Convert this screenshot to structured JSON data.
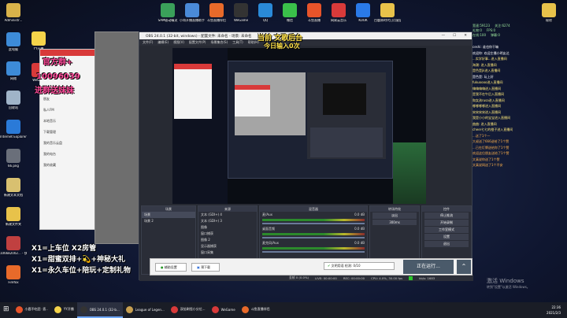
{
  "desktop_left": [
    {
      "label": "Administr...",
      "color": "#d8b24a"
    },
    {
      "label": "此电脑",
      "color": "#3d8bd8"
    },
    {
      "label": "网络",
      "color": "#3d8bd8"
    },
    {
      "label": "回收站",
      "color": "#a0b4c8"
    },
    {
      "label": "Internet Explorer",
      "color": "#2a7ad8"
    },
    {
      "label": "66.png",
      "color": "#6a6f7a"
    },
    {
      "label": "新建文本文档",
      "color": "#d8c070"
    },
    {
      "label": "新建文件夹",
      "color": "#e8c24a"
    },
    {
      "label": "106682002... - 快捷方式",
      "color": "#c04040"
    },
    {
      "label": "Firefox",
      "color": "#e86a2a"
    }
  ],
  "desktop_second_col": [
    {
      "label": "YY开播",
      "color": "#f5d44a"
    },
    {
      "label": "WeGa...",
      "color": "#d83a3a"
    }
  ],
  "desktop_top": [
    {
      "label": "SAM驱动精灵",
      "color": "#3aa05a"
    },
    {
      "label": "小哥开播直播助手",
      "color": "#4a8ad8"
    },
    {
      "label": "斗鱼直播伴侣",
      "color": "#e86a2a"
    },
    {
      "label": "WeGame",
      "color": "#333"
    },
    {
      "label": "QQ",
      "color": "#2a8ad8"
    },
    {
      "label": "微信",
      "color": "#3ac04a"
    },
    {
      "label": "斗鱼直播",
      "color": "#e8542a"
    },
    {
      "label": "网易云音乐",
      "color": "#d83a3a"
    },
    {
      "label": "KOOK",
      "color": "#2a7ae8"
    },
    {
      "label": "白鹿原时代日月星辰",
      "color": "#e8c24a"
    }
  ],
  "desktop_right_icon": {
    "label": "秘密",
    "color": "#e8c24a"
  },
  "obs": {
    "title": "OBS 24.0.1 (32-bit, windows) - 配置文件: 未命名 - 场景: 未命名",
    "menu": [
      "文件(F)",
      "编辑(E)",
      "视图(V)",
      "配置文件(P)",
      "场景集合(S)",
      "工具(T)",
      "帮助(H)"
    ],
    "scenes_header": "场景",
    "scenes": [
      "场景",
      "场景 2"
    ],
    "sources_header": "来源",
    "sources": [
      "文本 (GDI+) 4",
      "文本 (GDI+) 3",
      "图像",
      "窗口捕获",
      "图像 2",
      "显示器捕获",
      "窗口采集"
    ],
    "mixer_header": "混音器",
    "mixer": [
      {
        "name": "麦/Aux",
        "db": "0.0 dB"
      },
      {
        "name": "桌面音频",
        "db": "0.0 dB"
      },
      {
        "name": "麦克风/Aux",
        "db": "0.0 dB"
      }
    ],
    "transitions_header": "转场特效",
    "transition_type": "淡出",
    "transition_duration": "300ms",
    "controls_header": "控件",
    "controls": [
      "停止推流",
      "开始录制",
      "工作室模式",
      "设置",
      "退出"
    ],
    "status": {
      "dropped": "丢帧 0 (0.0%)",
      "live": "LIVE: 00:00:00",
      "rec": "REC: 00:00:00",
      "cpu": "CPU: 4.0%, 30.00 fps",
      "kbps": "kb/s: 1683"
    }
  },
  "preview_title": "当前 文歌后台",
  "preview_sub": "今日输入0次",
  "left_overlay": {
    "line1": "官方群+",
    "line2": "10096039",
    "line3": "进群送妹妹",
    "menu": [
      "消息",
      "朋友",
      "私人FM",
      "本地音乐",
      "下载管理",
      "我的音乐云盘",
      "我的电台",
      "我的收藏"
    ]
  },
  "bottom_overlay": {
    "x1": "X1=上车位 X2房管",
    "x2": "X1=甜蜜双排+💫+神秘大礼",
    "x3": "X1=永久车位+陪玩+定制礼物"
  },
  "chat_messages": [
    {
      "text": "ceshi: 谁也你干嘛",
      "cls": "w"
    },
    {
      "text": "欢迎你: 欢迎主播小明友达",
      "cls": "w"
    },
    {
      "text": "...实学好事...进入直播间",
      "cls": ""
    },
    {
      "text": "海潮: 进入直播间",
      "cls": ""
    },
    {
      "text": "是色是jk进入直播间",
      "cls": ""
    },
    {
      "text": "是色是: 玩上好",
      "cls": "w"
    },
    {
      "text": "fukuoooo进入直播间",
      "cls": ""
    },
    {
      "text": "嗨嗨嗨嗨进入直播间",
      "cls": ""
    },
    {
      "text": "是我不在午后入直播间",
      "cls": ""
    },
    {
      "text": "和女孩rusa进入直播间",
      "cls": ""
    },
    {
      "text": "哪哪哪哪进入直播间",
      "cls": ""
    },
    {
      "text": "宋宋宋宋进入直播间",
      "cls": ""
    },
    {
      "text": "我是小小的宝宝进入直播间",
      "cls": ""
    },
    {
      "text": "曲曲: 进入直播间",
      "cls": ""
    },
    {
      "text": "cheer七七的橙子进入直播间",
      "cls": ""
    },
    {
      "text": "...送了1个一",
      "cls": "o"
    },
    {
      "text": "大叔送了666送给了1个赞",
      "cls": "o"
    },
    {
      "text": "...已在灯牌送给你了1个赞",
      "cls": "o"
    },
    {
      "text": "欢迎这位朋友送给了1个赞",
      "cls": "o"
    },
    {
      "text": "文真说你送了1个赞",
      "cls": "o"
    },
    {
      "text": "文真说网送了1个不安",
      "cls": "o"
    }
  ],
  "stats": [
    {
      "k": "宽速:",
      "v": "59123"
    },
    {
      "k": "关注:",
      "v": "6274"
    },
    {
      "k": "礼物:",
      "v": "0"
    },
    {
      "k": "FPS:",
      "v": "0"
    },
    {
      "k": "在线:",
      "v": "100"
    },
    {
      "k": "弹幕:",
      "v": "0"
    }
  ],
  "dialog": {
    "check": "文明用语 检测: 0/10",
    "btn1": "辅助设置",
    "btn2": "预下载",
    "running": "正在运行..."
  },
  "watermark": {
    "line1": "激活 Windows",
    "line2": "转到\"设置\"以激活 Windows。"
  },
  "taskbar": {
    "items": [
      {
        "label": "小鹿不吃团 -直..",
        "color": "#e8542a"
      },
      {
        "label": "YY开播",
        "color": "#f5d44a"
      },
      {
        "label": "OBS 24.0.1 (32-b...",
        "color": "#333"
      },
      {
        "label": "League of Legen...",
        "color": "#c8a050"
      },
      {
        "label": "双倍刷怪小分位...",
        "color": "#d83a3a"
      },
      {
        "label": "WeGame",
        "color": "#d83a3a"
      },
      {
        "label": "斗鱼直播伴侣",
        "color": "#e86a2a"
      }
    ],
    "time": "22:36",
    "date": "2021/2/3"
  }
}
